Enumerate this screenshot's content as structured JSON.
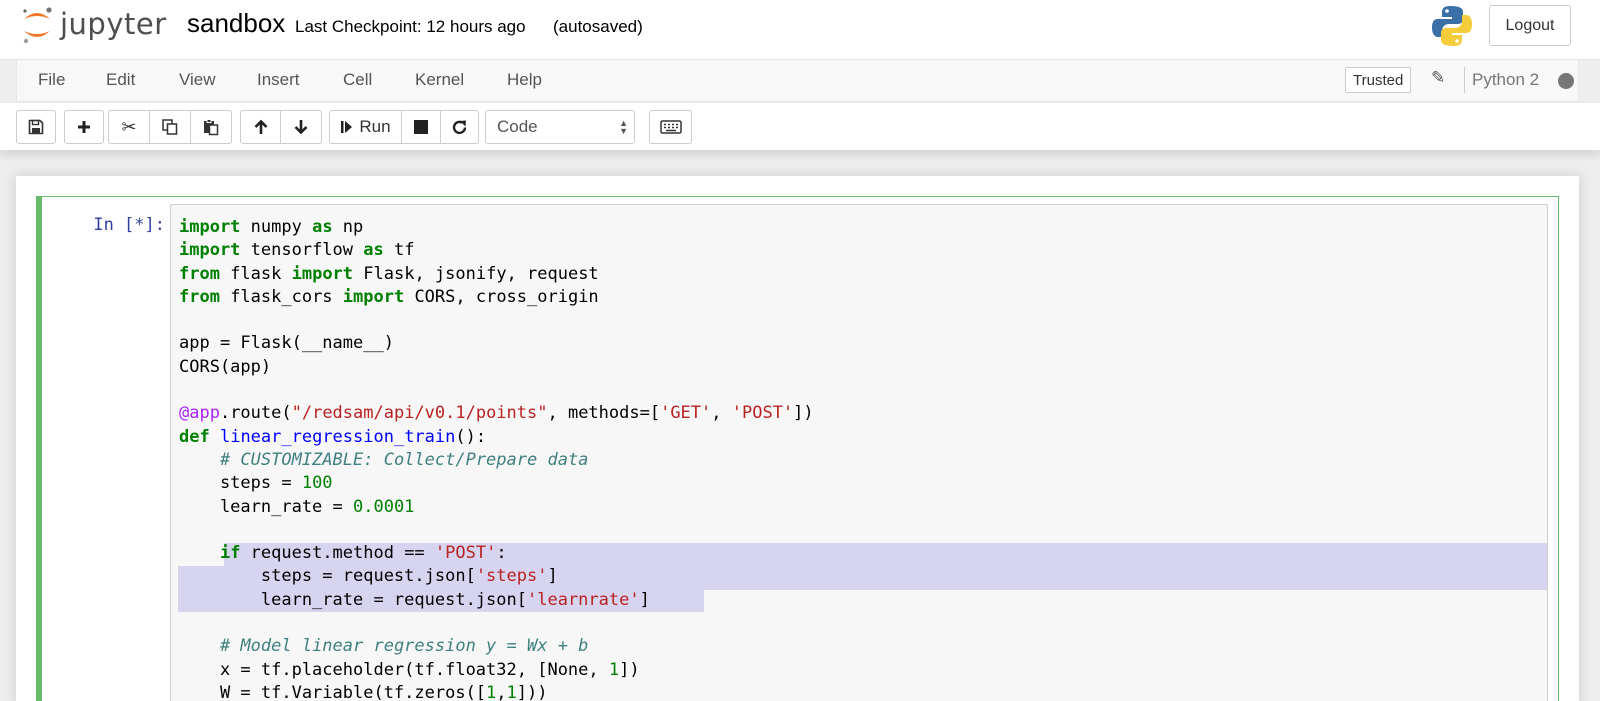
{
  "header": {
    "logo_text": "jupyter",
    "notebook_name": "sandbox",
    "checkpoint": "Last Checkpoint: 12 hours ago",
    "autosave": "(autosaved)",
    "logout_label": "Logout"
  },
  "menubar": {
    "items": [
      "File",
      "Edit",
      "View",
      "Insert",
      "Cell",
      "Kernel",
      "Help"
    ],
    "trusted_label": "Trusted",
    "kernel_name": "Python 2"
  },
  "toolbar": {
    "run_label": "Run",
    "cell_type": "Code"
  },
  "cell": {
    "prompt": "In [*]:",
    "code_lines": [
      "import numpy as np",
      "import tensorflow as tf",
      "from flask import Flask, jsonify, request",
      "from flask_cors import CORS, cross_origin",
      "",
      "app = Flask(__name__)",
      "CORS(app)",
      "",
      "@app.route(\"/redsam/api/v0.1/points\", methods=['GET', 'POST'])",
      "def linear_regression_train():",
      "    # CUSTOMIZABLE: Collect/Prepare data",
      "    steps = 100",
      "    learn_rate = 0.0001",
      "",
      "    if request.method == 'POST':",
      "        steps = request.json['steps']",
      "        learn_rate = request.json['learnrate']",
      "",
      "    # Model linear regression y = Wx + b",
      "    x = tf.placeholder(tf.float32, [None, 1])",
      "    W = tf.Variable(tf.zeros([1,1]))"
    ]
  },
  "colors": {
    "cell_border": "#66bb6a",
    "prompt": "#303f9f",
    "keyword": "#008000",
    "string": "#ba2121",
    "comment": "#408080",
    "selection": "#d7d4f0"
  },
  "icons": [
    "jupyter-logo",
    "python-logo",
    "save-icon",
    "plus-icon",
    "cut-icon",
    "copy-icon",
    "paste-icon",
    "arrow-up-icon",
    "arrow-down-icon",
    "run-icon",
    "stop-icon",
    "restart-icon",
    "keyboard-icon",
    "pencil-icon",
    "kernel-status-icon"
  ]
}
